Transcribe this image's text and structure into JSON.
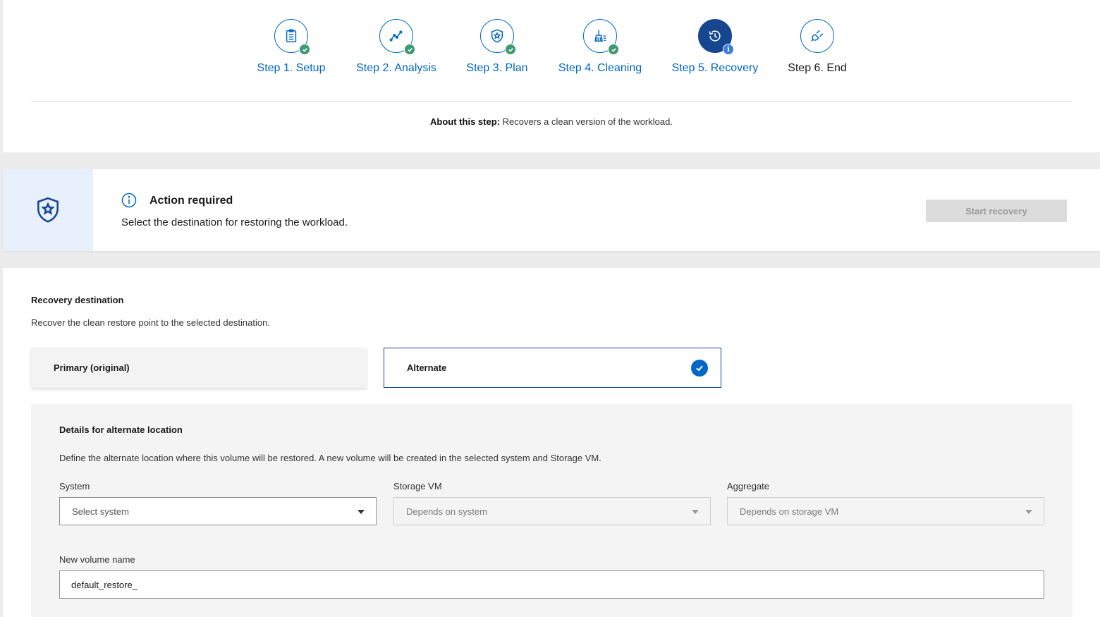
{
  "stepper": {
    "steps": [
      {
        "label": "Step 1. Setup",
        "icon": "clipboard-icon",
        "status": "done"
      },
      {
        "label": "Step 2. Analysis",
        "icon": "line-chart-icon",
        "status": "done"
      },
      {
        "label": "Step 3. Plan",
        "icon": "shield-star-icon",
        "status": "done"
      },
      {
        "label": "Step 4. Cleaning",
        "icon": "broom-icon",
        "status": "done"
      },
      {
        "label": "Step 5. Recovery",
        "icon": "history-icon",
        "status": "active"
      },
      {
        "label": "Step 6. End",
        "icon": "plug-icon",
        "status": "pending"
      }
    ],
    "about_label": "About this step:",
    "about_text": "Recovers a clean version of the workload."
  },
  "action": {
    "title": "Action required",
    "description": "Select the destination for restoring the workload.",
    "start_button": "Start recovery"
  },
  "recovery": {
    "title": "Recovery destination",
    "description": "Recover the clean restore point to the selected destination.",
    "options": {
      "primary": "Primary (original)",
      "alternate": "Alternate"
    },
    "selected": "alternate"
  },
  "details": {
    "title": "Details for alternate location",
    "description": "Define the alternate location where this volume will be restored. A new volume will be created in the selected system and Storage VM.",
    "system": {
      "label": "System",
      "value": "Select system"
    },
    "storage_vm": {
      "label": "Storage VM",
      "value": "Depends on system"
    },
    "aggregate": {
      "label": "Aggregate",
      "value": "Depends on storage VM"
    },
    "volume": {
      "label": "New volume name",
      "value": "default_restore_"
    }
  },
  "colors": {
    "accent": "#0067c5",
    "active_step": "#16468f",
    "done_badge": "#3d9a73",
    "banner_side": "#e8effd"
  }
}
